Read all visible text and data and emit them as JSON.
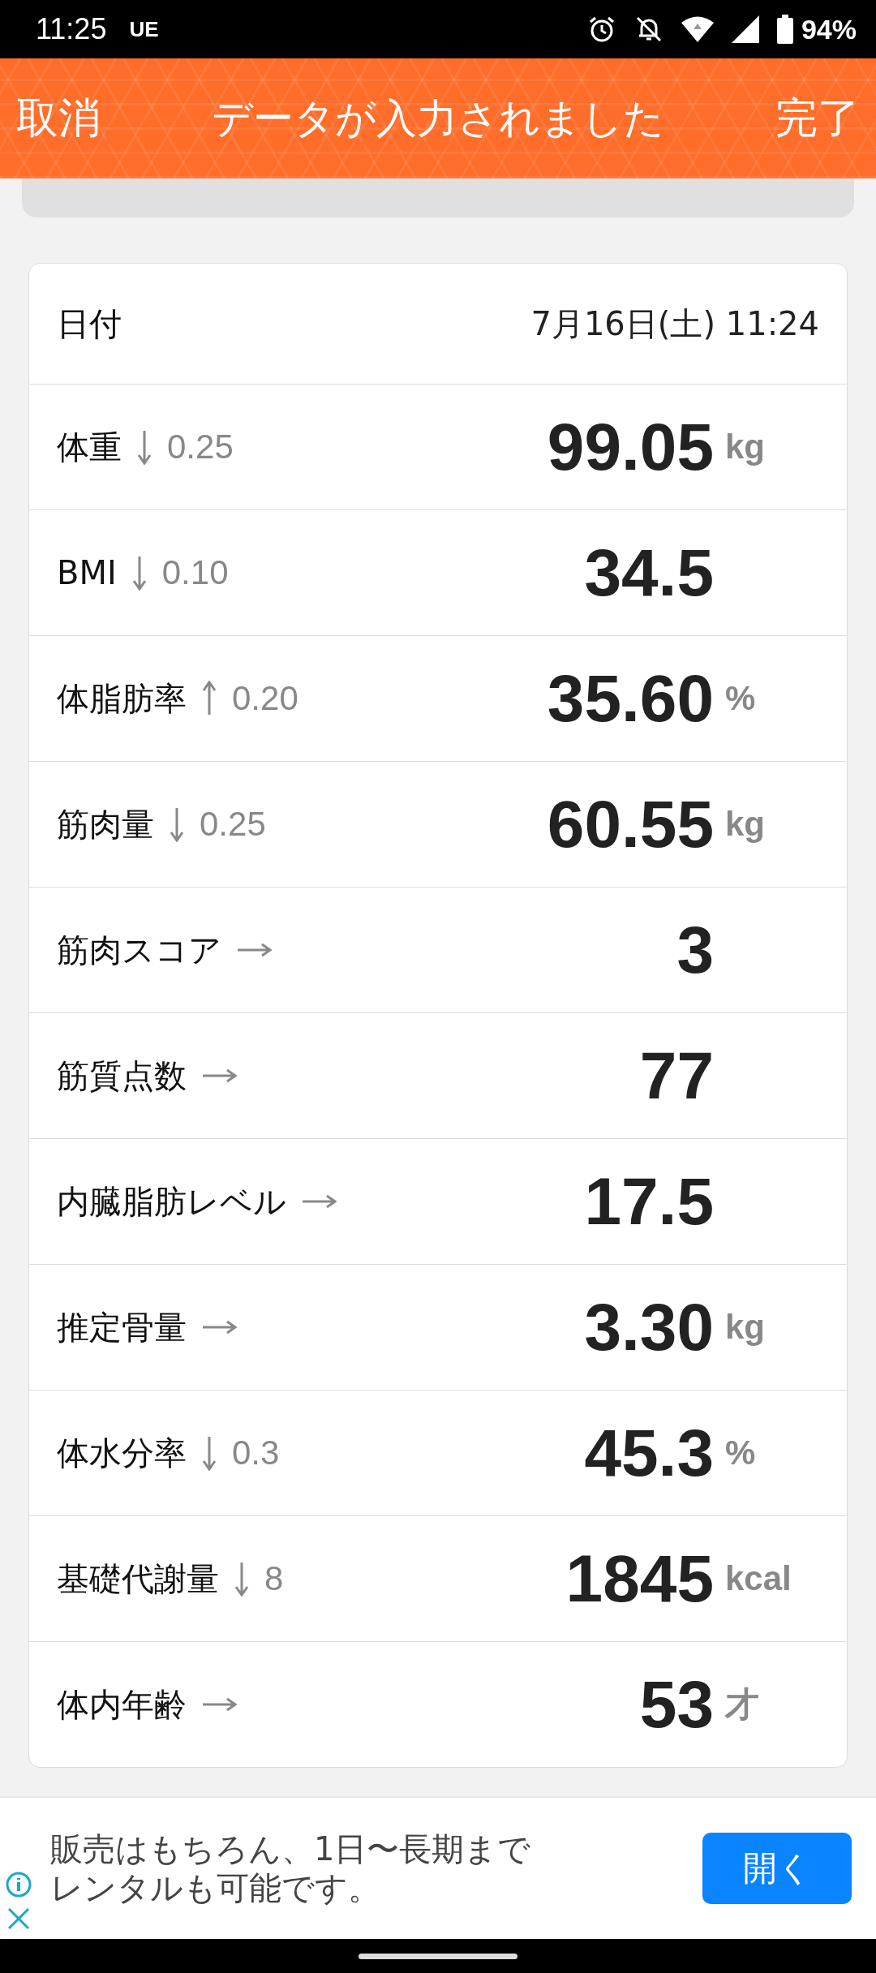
{
  "status_bar": {
    "time": "11:25",
    "carrier": "UE",
    "battery": "94%"
  },
  "header": {
    "cancel": "取消",
    "title": "データが入力されました",
    "done": "完了"
  },
  "date_row": {
    "label": "日付",
    "value": "7月16日(土) 11:24"
  },
  "rows": [
    {
      "label": "体重",
      "kind": "down",
      "delta": "0.25",
      "value": "99.05",
      "unit": "kg"
    },
    {
      "label": "BMI",
      "kind": "down",
      "delta": "0.10",
      "value": "34.5"
    },
    {
      "label": "体脂肪率",
      "kind": "up",
      "delta": "0.20",
      "value": "35.60",
      "unit": "%"
    },
    {
      "label": "筋肉量",
      "kind": "down",
      "delta": "0.25",
      "value": "60.55",
      "unit": "kg"
    },
    {
      "label": "筋肉スコア",
      "kind": "flat",
      "value": "3"
    },
    {
      "label": "筋質点数",
      "kind": "flat",
      "value": "77"
    },
    {
      "label": "内臓脂肪レベル",
      "kind": "flat",
      "value": "17.5"
    },
    {
      "label": "推定骨量",
      "kind": "flat",
      "value": "3.30",
      "unit": "kg"
    },
    {
      "label": "体水分率",
      "kind": "down",
      "delta": "0.3",
      "value": "45.3",
      "unit": "%"
    },
    {
      "label": "基礎代謝量",
      "kind": "down",
      "delta": "8",
      "value": "1845",
      "unit": "kcal"
    },
    {
      "label": "体内年齢",
      "kind": "flat",
      "value": "53",
      "unit": "才"
    }
  ],
  "ad": {
    "text": "販売はもちろん、1日〜長期までレンタルも可能です。",
    "button": "開く"
  }
}
